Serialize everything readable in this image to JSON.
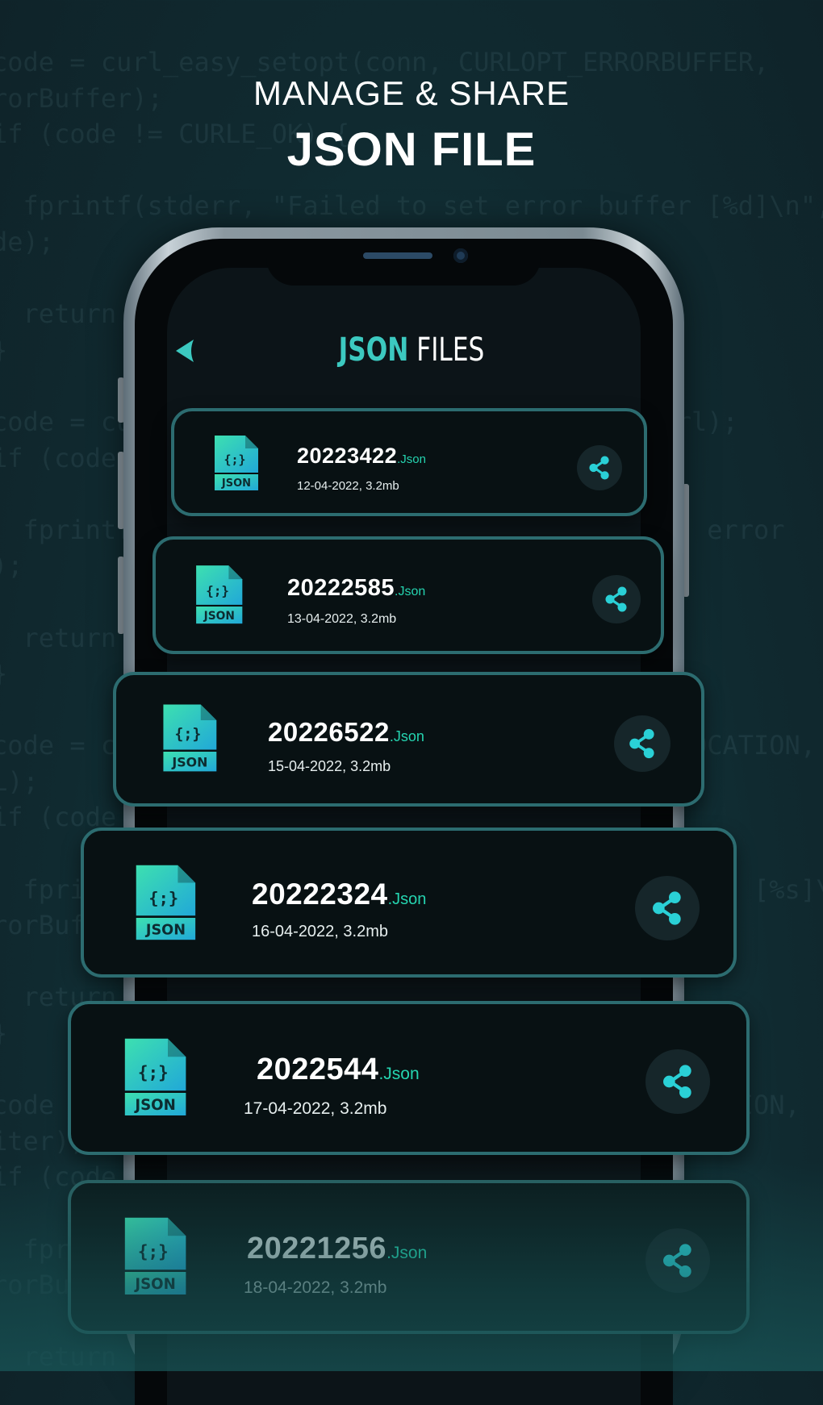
{
  "background_code": [
    "code = curl_easy_setopt(conn, CURLOPT_ERRORBUFFER,",
    "rorBuffer);",
    "if (code != CURLE_OK) {",
    "",
    "  fprintf(stderr, \"Failed to set error buffer [%d]\\n\",",
    "de);",
    "",
    "  return false;",
    "}",
    "",
    "code = curl_easy_setopt(conn, CURLOPT_URL, url);",
    "if (code != CURLE_OK) {",
    "",
    "  fprintf(stderr, \"Failed to set URL [%s]\\n\", error",
    ");",
    "",
    "  return false;",
    "}",
    "",
    "code = curl_easy_setopt(conn, CURLOPT_FOLLOWLOCATION,",
    "L);",
    "if (code != CURLE_OK) {",
    "",
    "  fprintf(stderr, \"Failed to set redirect option [%s]\\n\",",
    "rorBuffer);",
    "",
    "  return false;",
    "}",
    "",
    "code = curl_easy_setopt(conn, CURLOPT_WRITEFUNCTION,",
    "iter);",
    "if (code != CURLE_OK) {",
    "",
    "  fprintf(stderr, \"Failed to set writer [%s]\\n\",",
    "rorBuffer);",
    "",
    "  return false;"
  ],
  "headline": {
    "subtitle": "MANAGE & SHARE",
    "title": "JSON FILE"
  },
  "app": {
    "title_accent": "JSON",
    "title_rest": " FILES",
    "back_icon": "back-arrow-icon",
    "accent_color": "#3cc9c0"
  },
  "files": [
    {
      "name": "20223422",
      "ext": ".Json",
      "meta": "12-04-2022, 3.2mb",
      "icon_label": "JSON",
      "icon_glyph": "{;}"
    },
    {
      "name": "20222585",
      "ext": ".Json",
      "meta": "13-04-2022, 3.2mb",
      "icon_label": "JSON",
      "icon_glyph": "{;}"
    },
    {
      "name": "20226522",
      "ext": ".Json",
      "meta": "15-04-2022, 3.2mb",
      "icon_label": "JSON",
      "icon_glyph": "{;}"
    },
    {
      "name": "20222324",
      "ext": ".Json",
      "meta": "16-04-2022, 3.2mb",
      "icon_label": "JSON",
      "icon_glyph": "{;}"
    },
    {
      "name": "2022544",
      "ext": ".Json",
      "meta": "17-04-2022, 3.2mb",
      "icon_label": "JSON",
      "icon_glyph": "{;}"
    },
    {
      "name": "20221256",
      "ext": ".Json",
      "meta": "18-04-2022, 3.2mb",
      "icon_label": "JSON",
      "icon_glyph": "{;}"
    }
  ]
}
